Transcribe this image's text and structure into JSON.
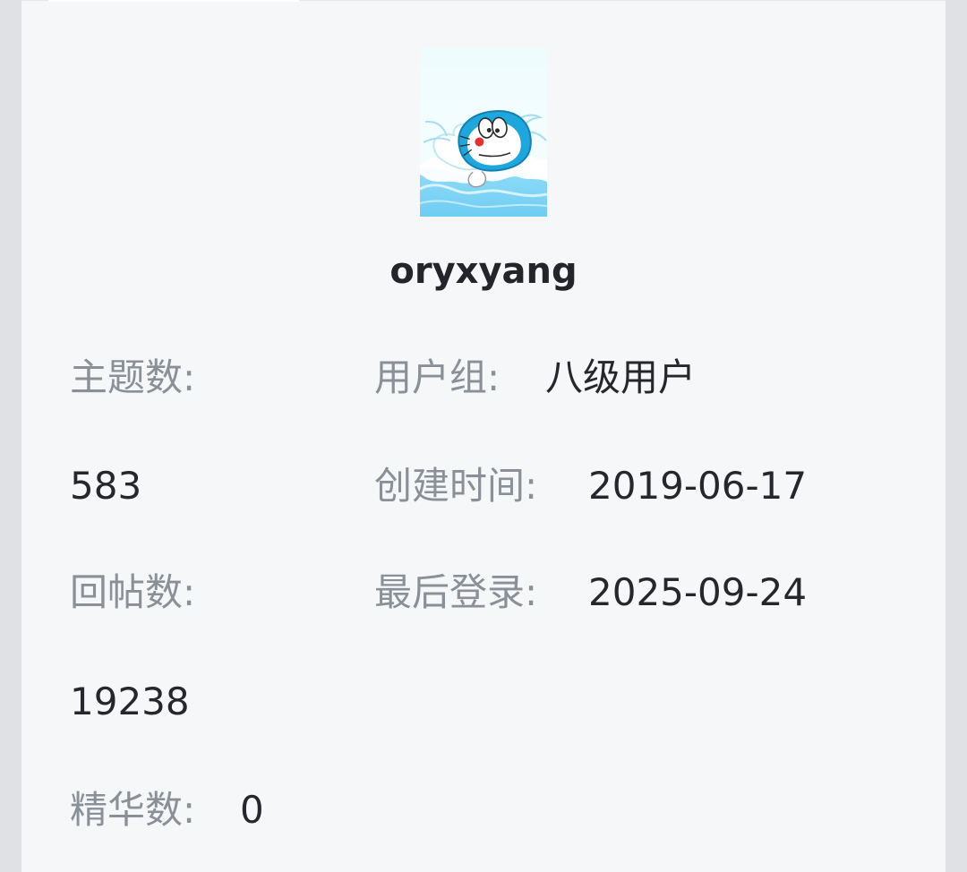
{
  "profile": {
    "username": "oryxyang",
    "avatar_icon": "doraemon-avatar"
  },
  "stats": {
    "topics_label": "主题数:",
    "topics_value": "583",
    "replies_label": "回帖数:",
    "replies_value": "19238",
    "featured_label": "精华数:",
    "featured_value": "0"
  },
  "meta": {
    "group_label": "用户组:",
    "group_value": "八级用户",
    "created_label": "创建时间:",
    "created_value": "2019-06-17",
    "last_login_label": "最后登录:",
    "last_login_value": "2025-09-24"
  },
  "colors": {
    "card_background": "#f6f7f9",
    "page_background": "#dfe1e4",
    "label_text": "#8a9097",
    "value_text": "#25272c"
  }
}
